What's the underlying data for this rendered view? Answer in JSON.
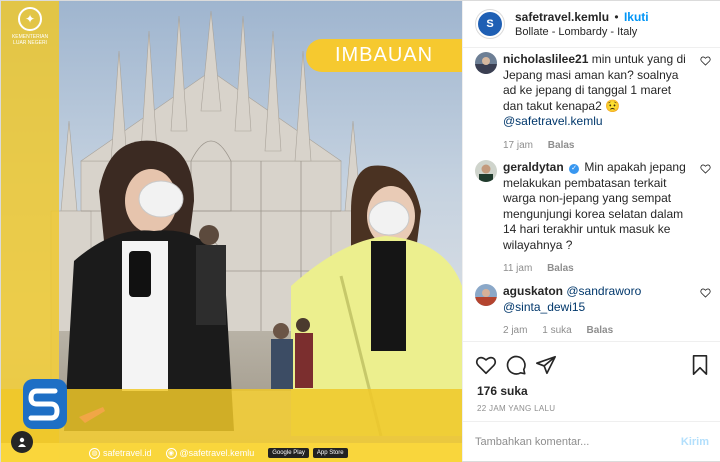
{
  "post": {
    "banner_label": "IMBAUAN",
    "ministry_logo_text": "KEMENTERIAN LUAR NEGERI",
    "footer": {
      "website": "safetravel.id",
      "handle": "@safetravel.kemlu",
      "google_play": "Google Play",
      "app_store": "App Store"
    }
  },
  "header": {
    "username": "safetravel.kemlu",
    "separator": "•",
    "follow_label": "Ikuti",
    "location": "Bollate - Lombardy - Italy",
    "avatar_text": "S"
  },
  "comments": [
    {
      "username": "nicholaslilee21",
      "text": "min untuk yang di Jepang masi aman kan? soalnya ad ke jepang di tanggal 1 maret dan takut kenapa2",
      "emoji": "😟",
      "mention": "@safetravel.kemlu",
      "time": "17 jam",
      "reply_label": "Balas"
    },
    {
      "username": "geraldytan",
      "verified": true,
      "text": "Min apakah jepang melakukan pembatasan terkait warga non-jepang yang sempat mengunjungi korea selatan dalam 14 hari terakhir untuk masuk ke wilayahnya ?",
      "time": "11 jam",
      "reply_label": "Balas"
    },
    {
      "username": "aguskaton",
      "mention1": "@sandraworo",
      "mention2": "@sinta_dewi15",
      "time": "2 jam",
      "likes": "1 suka",
      "reply_label": "Balas"
    }
  ],
  "actions": {
    "likes": "176 suka",
    "time_ago": "22 JAM YANG LALU"
  },
  "add_comment": {
    "placeholder": "Tambahkan komentar...",
    "post_label": "Kirim"
  },
  "colors": {
    "brand_yellow": "#f6c92f",
    "link_blue": "#0095f6",
    "mention_blue": "#00376b",
    "muted": "#8e8e8e"
  }
}
